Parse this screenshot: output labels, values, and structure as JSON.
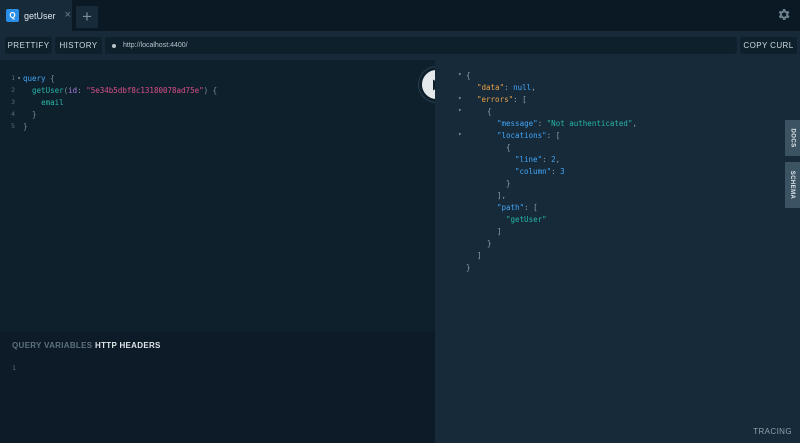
{
  "tabs": [
    {
      "badge": "Q",
      "title": "getUser",
      "close": "×"
    }
  ],
  "add_tab": "+",
  "toolbar": {
    "prettify": "PRETTIFY",
    "history": "HISTORY",
    "url": "http://localhost:4400/",
    "copy_curl": "COPY CURL"
  },
  "editor": {
    "line_numbers": [
      "1",
      "2",
      "3",
      "4",
      "5"
    ],
    "l1_query": "query",
    "l1_brace": " {",
    "l2_fn": "getUser",
    "l2_open": "(",
    "l2_arg": "id",
    "l2_colon": ": ",
    "l2_str": "\"5e34b5dbf8c13180078ad75e\"",
    "l2_close": ") {",
    "l3_field": "email",
    "l4_close": "}",
    "l5_close": "}"
  },
  "variables": {
    "tab_query_variables": "QUERY VARIABLES",
    "tab_http_headers": "HTTP HEADERS",
    "line1": "1"
  },
  "result": {
    "key_data": "\"data\"",
    "val_data": "null",
    "key_errors": "\"errors\"",
    "key_message": "\"message\"",
    "val_message": "\"Not authenticated\"",
    "key_locations": "\"locations\"",
    "key_line": "\"line\"",
    "val_line": "2",
    "key_column": "\"column\"",
    "val_column": "3",
    "key_path": "\"path\"",
    "val_path": "\"getUser\""
  },
  "side_tabs": {
    "docs": "DOCS",
    "schema": "SCHEMA"
  },
  "footer": {
    "tracing": "TRACING"
  },
  "colors": {
    "accent": "#2b8ee6",
    "background": "#0f202d",
    "panel": "#172a3a"
  }
}
